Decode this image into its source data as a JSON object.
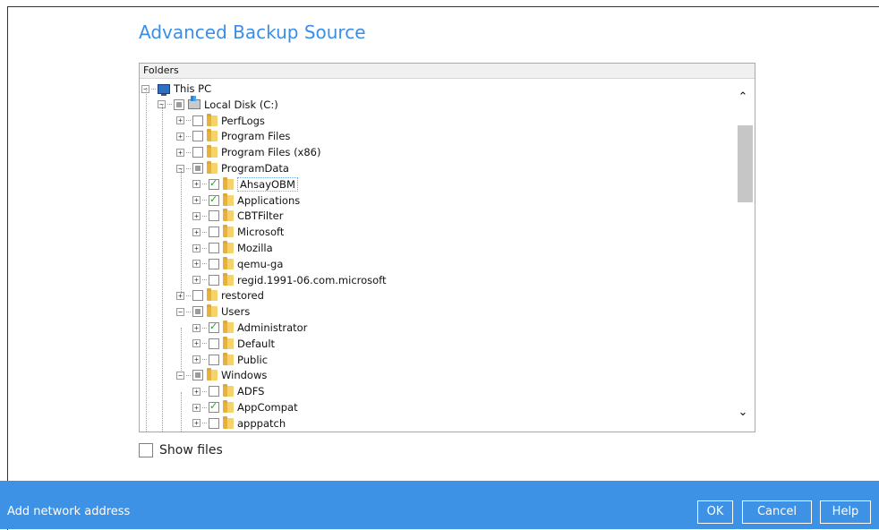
{
  "title": "Advanced Backup Source",
  "tree": {
    "header": "Folders",
    "nodes": [
      {
        "label": "This PC",
        "level": 0,
        "icon": "pc",
        "state": "none",
        "expander": "minus"
      },
      {
        "label": "Local Disk (C:)",
        "level": 1,
        "icon": "disk",
        "state": "partial",
        "expander": "minus"
      },
      {
        "label": "PerfLogs",
        "level": 2,
        "icon": "folder",
        "state": "unchecked",
        "expander": "plus"
      },
      {
        "label": "Program Files",
        "level": 2,
        "icon": "folder",
        "state": "unchecked",
        "expander": "plus"
      },
      {
        "label": "Program Files (x86)",
        "level": 2,
        "icon": "folder",
        "state": "unchecked",
        "expander": "plus"
      },
      {
        "label": "ProgramData",
        "level": 2,
        "icon": "folder",
        "state": "partial",
        "expander": "minus"
      },
      {
        "label": "AhsayOBM",
        "level": 3,
        "icon": "folder",
        "state": "checked",
        "expander": "plus",
        "selected": true
      },
      {
        "label": "Applications",
        "level": 3,
        "icon": "folder",
        "state": "checked",
        "expander": "plus"
      },
      {
        "label": "CBTFilter",
        "level": 3,
        "icon": "folder",
        "state": "unchecked",
        "expander": "plus"
      },
      {
        "label": "Microsoft",
        "level": 3,
        "icon": "folder",
        "state": "unchecked",
        "expander": "plus"
      },
      {
        "label": "Mozilla",
        "level": 3,
        "icon": "folder",
        "state": "unchecked",
        "expander": "plus"
      },
      {
        "label": "qemu-ga",
        "level": 3,
        "icon": "folder",
        "state": "unchecked",
        "expander": "plus"
      },
      {
        "label": "regid.1991-06.com.microsoft",
        "level": 3,
        "icon": "folder",
        "state": "unchecked",
        "expander": "plus"
      },
      {
        "label": "restored",
        "level": 2,
        "icon": "folder",
        "state": "unchecked",
        "expander": "plus"
      },
      {
        "label": "Users",
        "level": 2,
        "icon": "folder",
        "state": "partial",
        "expander": "minus"
      },
      {
        "label": "Administrator",
        "level": 3,
        "icon": "folder",
        "state": "checked",
        "expander": "plus"
      },
      {
        "label": "Default",
        "level": 3,
        "icon": "folder",
        "state": "unchecked",
        "expander": "plus"
      },
      {
        "label": "Public",
        "level": 3,
        "icon": "folder",
        "state": "unchecked",
        "expander": "plus"
      },
      {
        "label": "Windows",
        "level": 2,
        "icon": "folder",
        "state": "partial",
        "expander": "minus"
      },
      {
        "label": "ADFS",
        "level": 3,
        "icon": "folder",
        "state": "unchecked",
        "expander": "plus"
      },
      {
        "label": "AppCompat",
        "level": 3,
        "icon": "folder",
        "state": "checked",
        "expander": "plus"
      },
      {
        "label": "apppatch",
        "level": 3,
        "icon": "folder",
        "state": "unchecked",
        "expander": "plus"
      }
    ]
  },
  "show_files": {
    "label": "Show files",
    "checked": false
  },
  "footer": {
    "add_network_address": "Add network address",
    "ok": "OK",
    "cancel": "Cancel",
    "help": "Help"
  },
  "colors": {
    "accent": "#3d92e6",
    "title": "#3a8ee6",
    "check": "#2a9d2a"
  }
}
